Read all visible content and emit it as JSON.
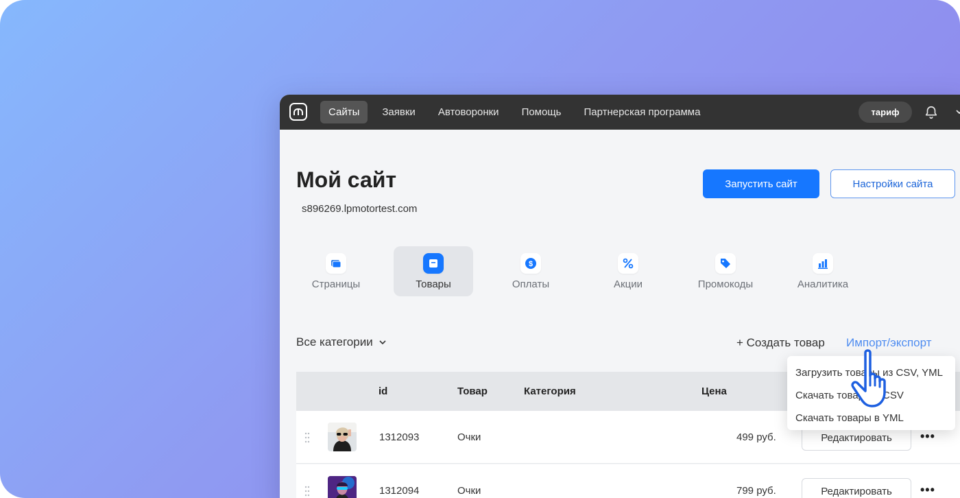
{
  "nav": {
    "items": [
      {
        "label": "Сайты",
        "active": true
      },
      {
        "label": "Заявки",
        "active": false
      },
      {
        "label": "Автоворонки",
        "active": false
      },
      {
        "label": "Помощь",
        "active": false
      },
      {
        "label": "Партнерская программа",
        "active": false
      }
    ],
    "tariff_label": "тариф"
  },
  "header": {
    "title": "Мой сайт",
    "url": "s896269.lpmotortest.com",
    "launch_label": "Запустить сайт",
    "settings_label": "Настройки сайта"
  },
  "tabs": [
    {
      "label": "Страницы",
      "icon": "pages-icon"
    },
    {
      "label": "Товары",
      "icon": "products-icon",
      "active": true
    },
    {
      "label": "Оплаты",
      "icon": "dollar-icon"
    },
    {
      "label": "Акции",
      "icon": "percent-icon"
    },
    {
      "label": "Промокоды",
      "icon": "tag-icon"
    },
    {
      "label": "Аналитика",
      "icon": "chart-icon"
    }
  ],
  "toolbar": {
    "category_filter": "Все категории",
    "create_label": "+ Создать товар",
    "import_label": "Импорт/экспорт"
  },
  "table": {
    "headers": {
      "id": "id",
      "product": "Товар",
      "category": "Категория",
      "price": "Цена"
    },
    "rows": [
      {
        "id": "1312093",
        "product": "Очки",
        "category": "",
        "price": "499 руб.",
        "edit_label": "Редактировать"
      },
      {
        "id": "1312094",
        "product": "Очки",
        "category": "",
        "price": "799 руб.",
        "edit_label": "Редактировать"
      }
    ]
  },
  "menu": {
    "items": [
      "Загрузить товары из CSV, YML",
      "Скачать товары в CSV",
      "Скачать товары в YML"
    ]
  },
  "colors": {
    "accent": "#1677ff",
    "nav_bg": "#333333",
    "link": "#4e8cf0"
  }
}
